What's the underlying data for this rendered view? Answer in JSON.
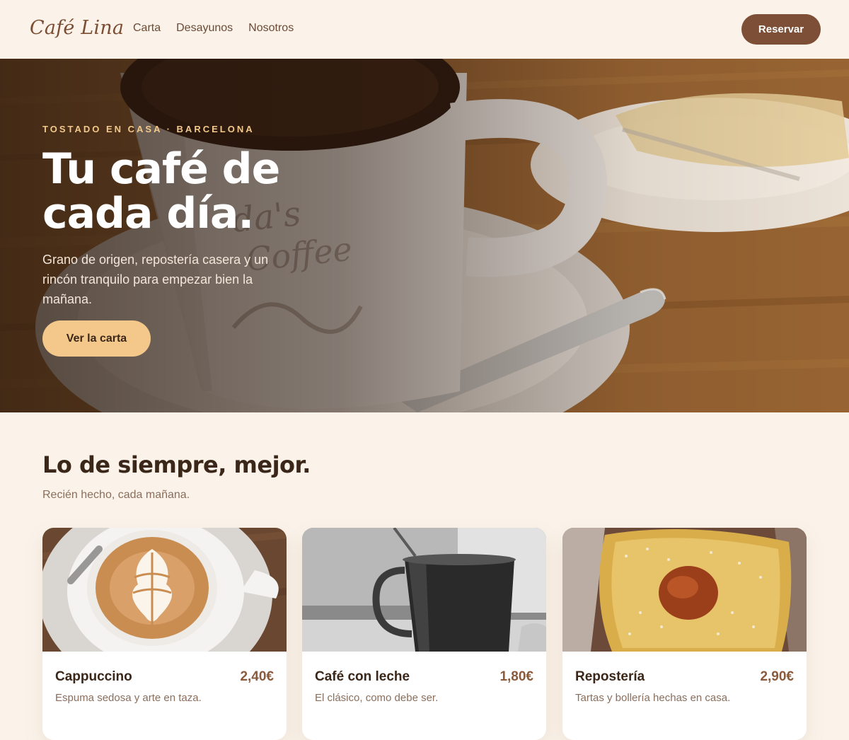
{
  "nav": {
    "logo": "Café Lina",
    "links": [
      "Carta",
      "Desayunos",
      "Nosotros"
    ],
    "cta_label": "Reservar"
  },
  "hero": {
    "eyebrow": "TOSTADO EN CASA · BARCELONA",
    "title": "Tu café de cada día.",
    "text": "Grano de origen, repostería casera y un rincón tranquilo para empezar bien la mañana.",
    "cta_label": "Ver la carta"
  },
  "section": {
    "title": "Lo de siempre, mejor.",
    "subtitle": "Recién hecho, cada mañana."
  },
  "products": [
    {
      "name": "Cappuccino",
      "price": "2,40€",
      "desc": "Espuma sedosa y arte en taza."
    },
    {
      "name": "Café con leche",
      "price": "1,80€",
      "desc": "El clásico, como debe ser."
    },
    {
      "name": "Repostería",
      "price": "2,90€",
      "desc": "Tartas y bollería hechas en casa."
    }
  ],
  "colors": {
    "background": "#fbf3ea",
    "accent_brown": "#7d4f36",
    "accent_cream": "#f3c88a",
    "text_dark": "#3b2719",
    "text_muted": "#8a6e5b"
  }
}
